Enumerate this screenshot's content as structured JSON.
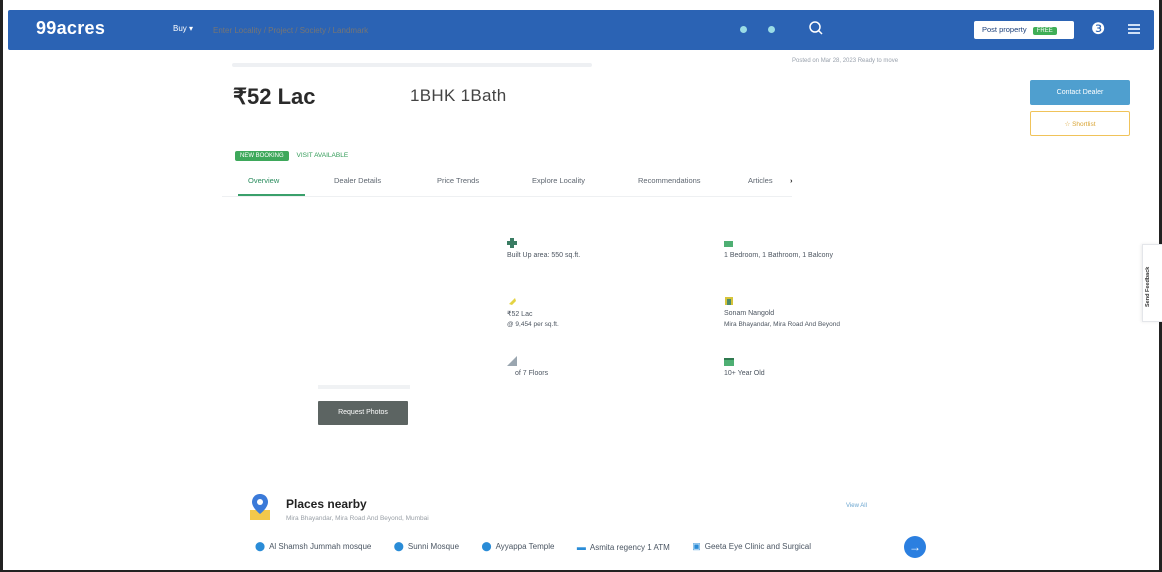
{
  "header": {
    "logo": "99acres",
    "buy_dropdown": "Buy ▾",
    "search_placeholder": "Enter Locality / Project / Society / Landmark",
    "post_property": "Post property",
    "post_property_badge": "FREE",
    "brand_color": "#2b63b4"
  },
  "listing": {
    "posted": "Posted on Mar 28, 2023   Ready to move",
    "price": "₹52 Lac",
    "config": "1BHK 1Bath",
    "contact_button": "Contact Dealer",
    "shortlist_button": "Shortlist",
    "new_badge": "NEW BOOKING",
    "visit_label": "VISIT AVAILABLE"
  },
  "tabs": [
    {
      "label": "Overview",
      "active": true
    },
    {
      "label": "Dealer Details",
      "active": false
    },
    {
      "label": "Price Trends",
      "active": false
    },
    {
      "label": "Explore Locality",
      "active": false
    },
    {
      "label": "Recommendations",
      "active": false
    },
    {
      "label": "Articles",
      "active": false
    }
  ],
  "photos": {
    "request_button": "Request Photos"
  },
  "features": {
    "area": {
      "value": "Built Up area: 550 sq.ft."
    },
    "config": {
      "value": "1 Bedroom, 1 Bathroom, 1 Balcony"
    },
    "price": {
      "value": "₹52 Lac",
      "value2": "@ 9,454 per sq.ft."
    },
    "address": {
      "value": "Sonam Nangold",
      "value2": "Mira Bhayandar, Mira Road And Beyond"
    },
    "floor": {
      "value": "of 7 Floors"
    },
    "age": {
      "value": "10+ Year Old"
    }
  },
  "places": {
    "title": "Places nearby",
    "subtitle": "Mira Bhayandar, Mira Road And Beyond, Mumbai",
    "view_all": "View All",
    "items": [
      {
        "icon": "pin-icon",
        "label": "Al Shamsh Jummah mosque"
      },
      {
        "icon": "pin-icon",
        "label": "Sunni Mosque"
      },
      {
        "icon": "pin-icon",
        "label": "Ayyappa Temple"
      },
      {
        "icon": "atm-icon",
        "label": "Asmita regency 1 ATM"
      },
      {
        "icon": "clinic-icon",
        "label": "Geeta Eye Clinic and Surgical"
      }
    ]
  },
  "feedback": "Send Feedback"
}
